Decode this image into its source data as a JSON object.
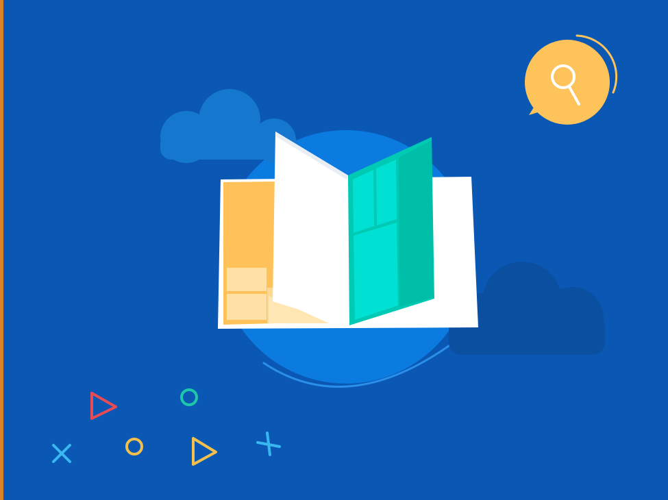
{
  "illustration": {
    "subject": "open book",
    "icons": [
      "search-icon",
      "cloud-icon",
      "play-icon",
      "circle-icon",
      "cross-icon"
    ]
  },
  "colors": {
    "background": "#0a58b4",
    "left_edge_accent": "#d9822b",
    "globe": "#0b7be0",
    "cloud_light": "#1677cf",
    "cloud_dark": "#0a4fa0",
    "page_white": "#ffffff",
    "panel_orange": "#ffc25a",
    "panel_teal": "#00c9b4",
    "search_badge": "#ffc35c",
    "shape_red": "#e74b55",
    "shape_teal": "#1ec8a8",
    "shape_yellow": "#f3c04d",
    "shape_cyan": "#39b7f0"
  }
}
